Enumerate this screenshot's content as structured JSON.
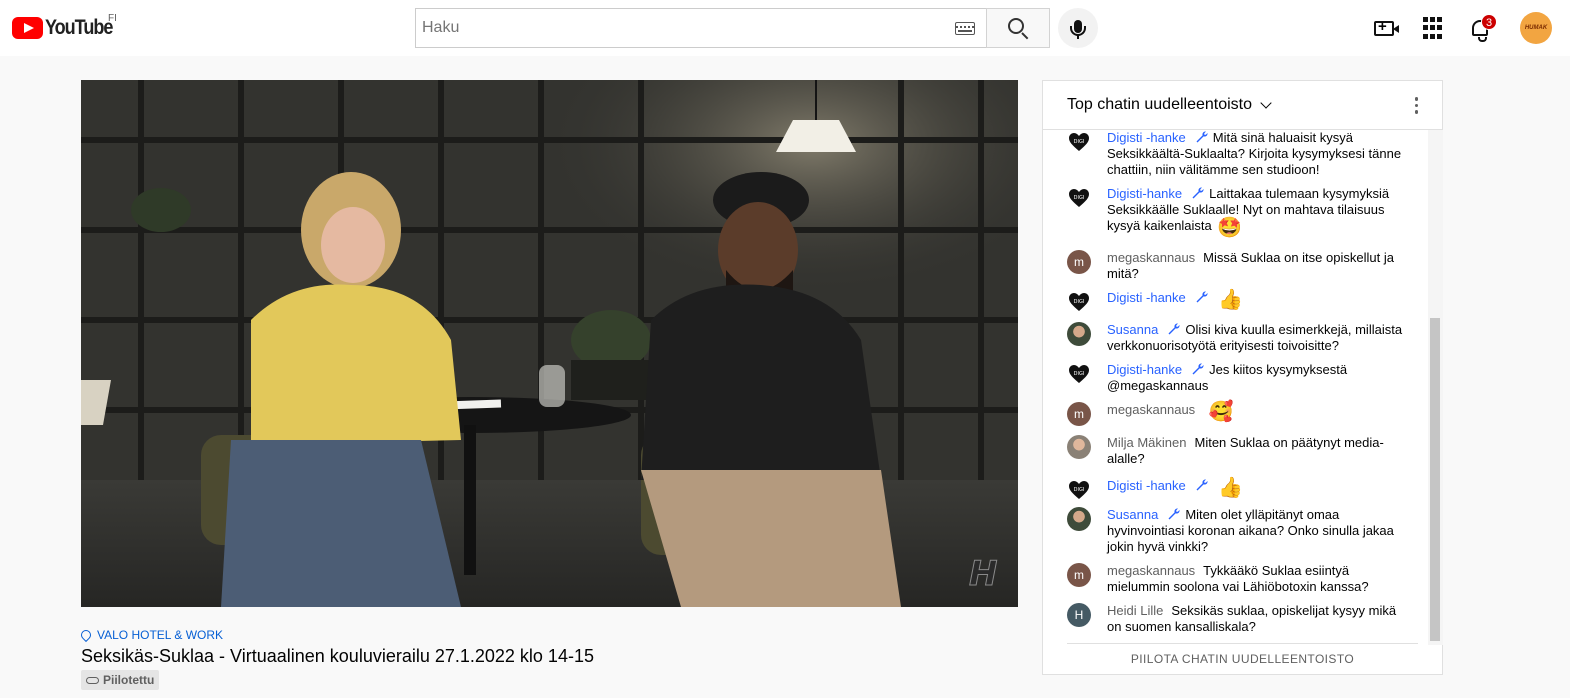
{
  "header": {
    "logo_text": "YouTube",
    "country_code": "FI",
    "search_placeholder": "Haku",
    "notification_count": "3",
    "avatar_label": "HUMAK"
  },
  "video": {
    "location": "VALO HOTEL & WORK",
    "title": "Seksikäs-Suklaa - Virtuaalinen kouluvierailu 27.1.2022 klo 14-15",
    "visibility": "Piilotettu"
  },
  "chat": {
    "header_title": "Top chatin uudelleentoisto",
    "footer_label": "PIILOTA CHATIN UUDELLEENTOISTO",
    "messages": [
      {
        "author": "Digisti -hanke",
        "text": "Mitä sinä haluaisit kysyä Seksikkäältä-Suklaalta? Kirjoita kysymyksesi tänne chattiin, niin välitämme sen studioon!",
        "owner": true,
        "avatar": "heart"
      },
      {
        "author": "Digisti-hanke",
        "text": "Laittakaa tulemaan kysymyksiä Seksikkäälle Suklaalle! Nyt on mahtava tilaisuus kysyä kaikenlaista",
        "emoji": "🤩",
        "owner": true,
        "avatar": "heart"
      },
      {
        "author": "megaskannaus",
        "text": "Missä Suklaa on itse opiskellut ja mitä?",
        "owner": false,
        "avatar": "m"
      },
      {
        "author": "Digisti -hanke",
        "text": "",
        "emoji": "👍",
        "owner": true,
        "avatar": "heart"
      },
      {
        "author": "Susanna",
        "text": "Olisi kiva kuulla esimerkkejä, millaista verkkonuorisotyötä erityisesti toivoisitte?",
        "owner": true,
        "avatar": "photo1"
      },
      {
        "author": "Digisti-hanke",
        "text": "Jes kiitos kysymyksestä @megaskannaus",
        "owner": true,
        "avatar": "heart"
      },
      {
        "author": "megaskannaus",
        "text": "",
        "emoji": "🥰",
        "owner": false,
        "avatar": "m"
      },
      {
        "author": "Milja Mäkinen",
        "text": "Miten Suklaa on päätynyt media-alalle?",
        "owner": false,
        "avatar": "photo2"
      },
      {
        "author": "Digisti -hanke",
        "text": "",
        "emoji": "👍",
        "owner": true,
        "avatar": "heart"
      },
      {
        "author": "Susanna",
        "text": "Miten olet ylläpitänyt omaa hyvinvointiasi koronan aikana? Onko sinulla jakaa jokin hyvä vinkki?",
        "owner": true,
        "avatar": "photo1"
      },
      {
        "author": "megaskannaus",
        "text": "Tykkääkö Suklaa esiintyä mielummin soolona vai Lähiöbotoxin kanssa?",
        "owner": false,
        "avatar": "m"
      },
      {
        "author": "Heidi Lille",
        "text": "Seksikäs suklaa, opiskelijat kysyy mikä on suomen kansalliskala?",
        "owner": false,
        "avatar": "H"
      }
    ]
  },
  "colors": {
    "owner_blue": "#2962ff",
    "link_blue": "#065fd4",
    "brand_red": "#ff0000"
  }
}
